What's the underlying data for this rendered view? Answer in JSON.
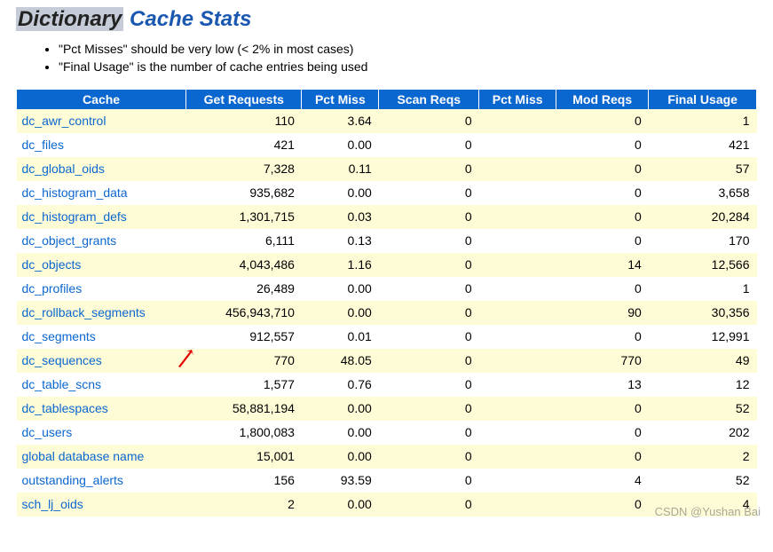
{
  "title_part1": "Dictionary",
  "title_part2": " Cache Stats",
  "notes": [
    "\"Pct Misses\" should be very low (< 2% in most cases)",
    "\"Final Usage\" is the number of cache entries being used"
  ],
  "headers": {
    "cache": "Cache",
    "get_requests": "Get Requests",
    "pct_miss1": "Pct Miss",
    "scan_reqs": "Scan Reqs",
    "pct_miss2": "Pct Miss",
    "mod_reqs": "Mod Reqs",
    "final_usage": "Final Usage"
  },
  "rows": [
    {
      "cache": "dc_awr_control",
      "get_requests": "110",
      "pct_miss1": "3.64",
      "scan_reqs": "0",
      "pct_miss2": "",
      "mod_reqs": "0",
      "final_usage": "1"
    },
    {
      "cache": "dc_files",
      "get_requests": "421",
      "pct_miss1": "0.00",
      "scan_reqs": "0",
      "pct_miss2": "",
      "mod_reqs": "0",
      "final_usage": "421"
    },
    {
      "cache": "dc_global_oids",
      "get_requests": "7,328",
      "pct_miss1": "0.11",
      "scan_reqs": "0",
      "pct_miss2": "",
      "mod_reqs": "0",
      "final_usage": "57"
    },
    {
      "cache": "dc_histogram_data",
      "get_requests": "935,682",
      "pct_miss1": "0.00",
      "scan_reqs": "0",
      "pct_miss2": "",
      "mod_reqs": "0",
      "final_usage": "3,658"
    },
    {
      "cache": "dc_histogram_defs",
      "get_requests": "1,301,715",
      "pct_miss1": "0.03",
      "scan_reqs": "0",
      "pct_miss2": "",
      "mod_reqs": "0",
      "final_usage": "20,284"
    },
    {
      "cache": "dc_object_grants",
      "get_requests": "6,111",
      "pct_miss1": "0.13",
      "scan_reqs": "0",
      "pct_miss2": "",
      "mod_reqs": "0",
      "final_usage": "170"
    },
    {
      "cache": "dc_objects",
      "get_requests": "4,043,486",
      "pct_miss1": "1.16",
      "scan_reqs": "0",
      "pct_miss2": "",
      "mod_reqs": "14",
      "final_usage": "12,566"
    },
    {
      "cache": "dc_profiles",
      "get_requests": "26,489",
      "pct_miss1": "0.00",
      "scan_reqs": "0",
      "pct_miss2": "",
      "mod_reqs": "0",
      "final_usage": "1"
    },
    {
      "cache": "dc_rollback_segments",
      "get_requests": "456,943,710",
      "pct_miss1": "0.00",
      "scan_reqs": "0",
      "pct_miss2": "",
      "mod_reqs": "90",
      "final_usage": "30,356"
    },
    {
      "cache": "dc_segments",
      "get_requests": "912,557",
      "pct_miss1": "0.01",
      "scan_reqs": "0",
      "pct_miss2": "",
      "mod_reqs": "0",
      "final_usage": "12,991"
    },
    {
      "cache": "dc_sequences",
      "get_requests": "770",
      "pct_miss1": "48.05",
      "scan_reqs": "0",
      "pct_miss2": "",
      "mod_reqs": "770",
      "final_usage": "49"
    },
    {
      "cache": "dc_table_scns",
      "get_requests": "1,577",
      "pct_miss1": "0.76",
      "scan_reqs": "0",
      "pct_miss2": "",
      "mod_reqs": "13",
      "final_usage": "12"
    },
    {
      "cache": "dc_tablespaces",
      "get_requests": "58,881,194",
      "pct_miss1": "0.00",
      "scan_reqs": "0",
      "pct_miss2": "",
      "mod_reqs": "0",
      "final_usage": "52"
    },
    {
      "cache": "dc_users",
      "get_requests": "1,800,083",
      "pct_miss1": "0.00",
      "scan_reqs": "0",
      "pct_miss2": "",
      "mod_reqs": "0",
      "final_usage": "202"
    },
    {
      "cache": "global database name",
      "get_requests": "15,001",
      "pct_miss1": "0.00",
      "scan_reqs": "0",
      "pct_miss2": "",
      "mod_reqs": "0",
      "final_usage": "2"
    },
    {
      "cache": "outstanding_alerts",
      "get_requests": "156",
      "pct_miss1": "93.59",
      "scan_reqs": "0",
      "pct_miss2": "",
      "mod_reqs": "4",
      "final_usage": "52"
    },
    {
      "cache": "sch_lj_oids",
      "get_requests": "2",
      "pct_miss1": "0.00",
      "scan_reqs": "0",
      "pct_miss2": "",
      "mod_reqs": "0",
      "final_usage": "4"
    }
  ],
  "watermark": "CSDN @Yushan Bai"
}
